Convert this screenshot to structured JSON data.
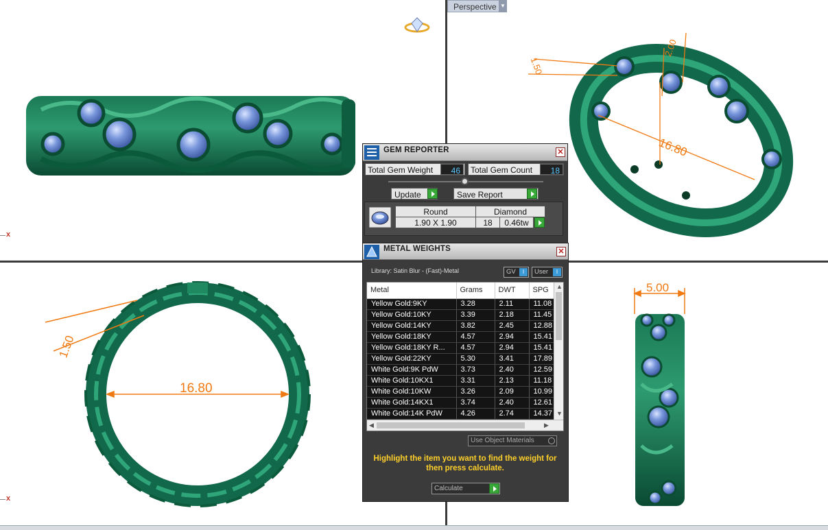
{
  "viewport": {
    "perspective_label": "Perspective",
    "axis_label": "x"
  },
  "dimensions": {
    "top_right_diameter": "16.80",
    "top_right_small_a": "1.50",
    "top_right_small_b": "2.00",
    "bottom_left_diameter": "16.80",
    "bottom_left_thickness": "1.50",
    "bottom_right_width": "5.00"
  },
  "gem_reporter": {
    "title": "GEM REPORTER",
    "total_weight_label": "Total Gem Weight",
    "total_weight_value": "46",
    "total_count_label": "Total Gem Count",
    "total_count_value": "18",
    "update_label": "Update",
    "save_report_label": "Save Report",
    "gem": {
      "shape": "Round",
      "material": "Diamond",
      "size": "1.90 X 1.90",
      "count": "18",
      "weight": "0.46tw"
    }
  },
  "metal_weights": {
    "title": "METAL WEIGHTS",
    "library": "Library: Satin Blur - (Fast)-Metal",
    "toggle_gv": "GV",
    "toggle_user": "User",
    "columns": [
      "Metal",
      "Grams",
      "DWT",
      "SPG"
    ],
    "rows": [
      [
        "Yellow Gold:9KY",
        "3.28",
        "2.11",
        "11.08"
      ],
      [
        "Yellow Gold:10KY",
        "3.39",
        "2.18",
        "11.45"
      ],
      [
        "Yellow Gold:14KY",
        "3.82",
        "2.45",
        "12.88"
      ],
      [
        "Yellow Gold:18KY",
        "4.57",
        "2.94",
        "15.41"
      ],
      [
        "Yellow Gold:18KY R...",
        "4.57",
        "2.94",
        "15.41"
      ],
      [
        "Yellow Gold:22KY",
        "5.30",
        "3.41",
        "17.89"
      ],
      [
        "White Gold:9K PdW",
        "3.73",
        "2.40",
        "12.59"
      ],
      [
        "White Gold:10KX1",
        "3.31",
        "2.13",
        "11.18"
      ],
      [
        "White Gold:10KW",
        "3.26",
        "2.09",
        "10.99"
      ],
      [
        "White Gold:14KX1",
        "3.74",
        "2.40",
        "12.61"
      ],
      [
        "White Gold:14K PdW",
        "4.26",
        "2.74",
        "14.37"
      ]
    ],
    "use_object_materials": "Use Object Materials",
    "hint": "Highlight the item you want to find the weight for then press calculate.",
    "calculate_label": "Calculate"
  },
  "colors": {
    "ring_green": "#12684a",
    "ring_highlight": "#2fa57a",
    "gem_blue": "#6f8fd6",
    "dimension_orange": "#f07a12"
  }
}
